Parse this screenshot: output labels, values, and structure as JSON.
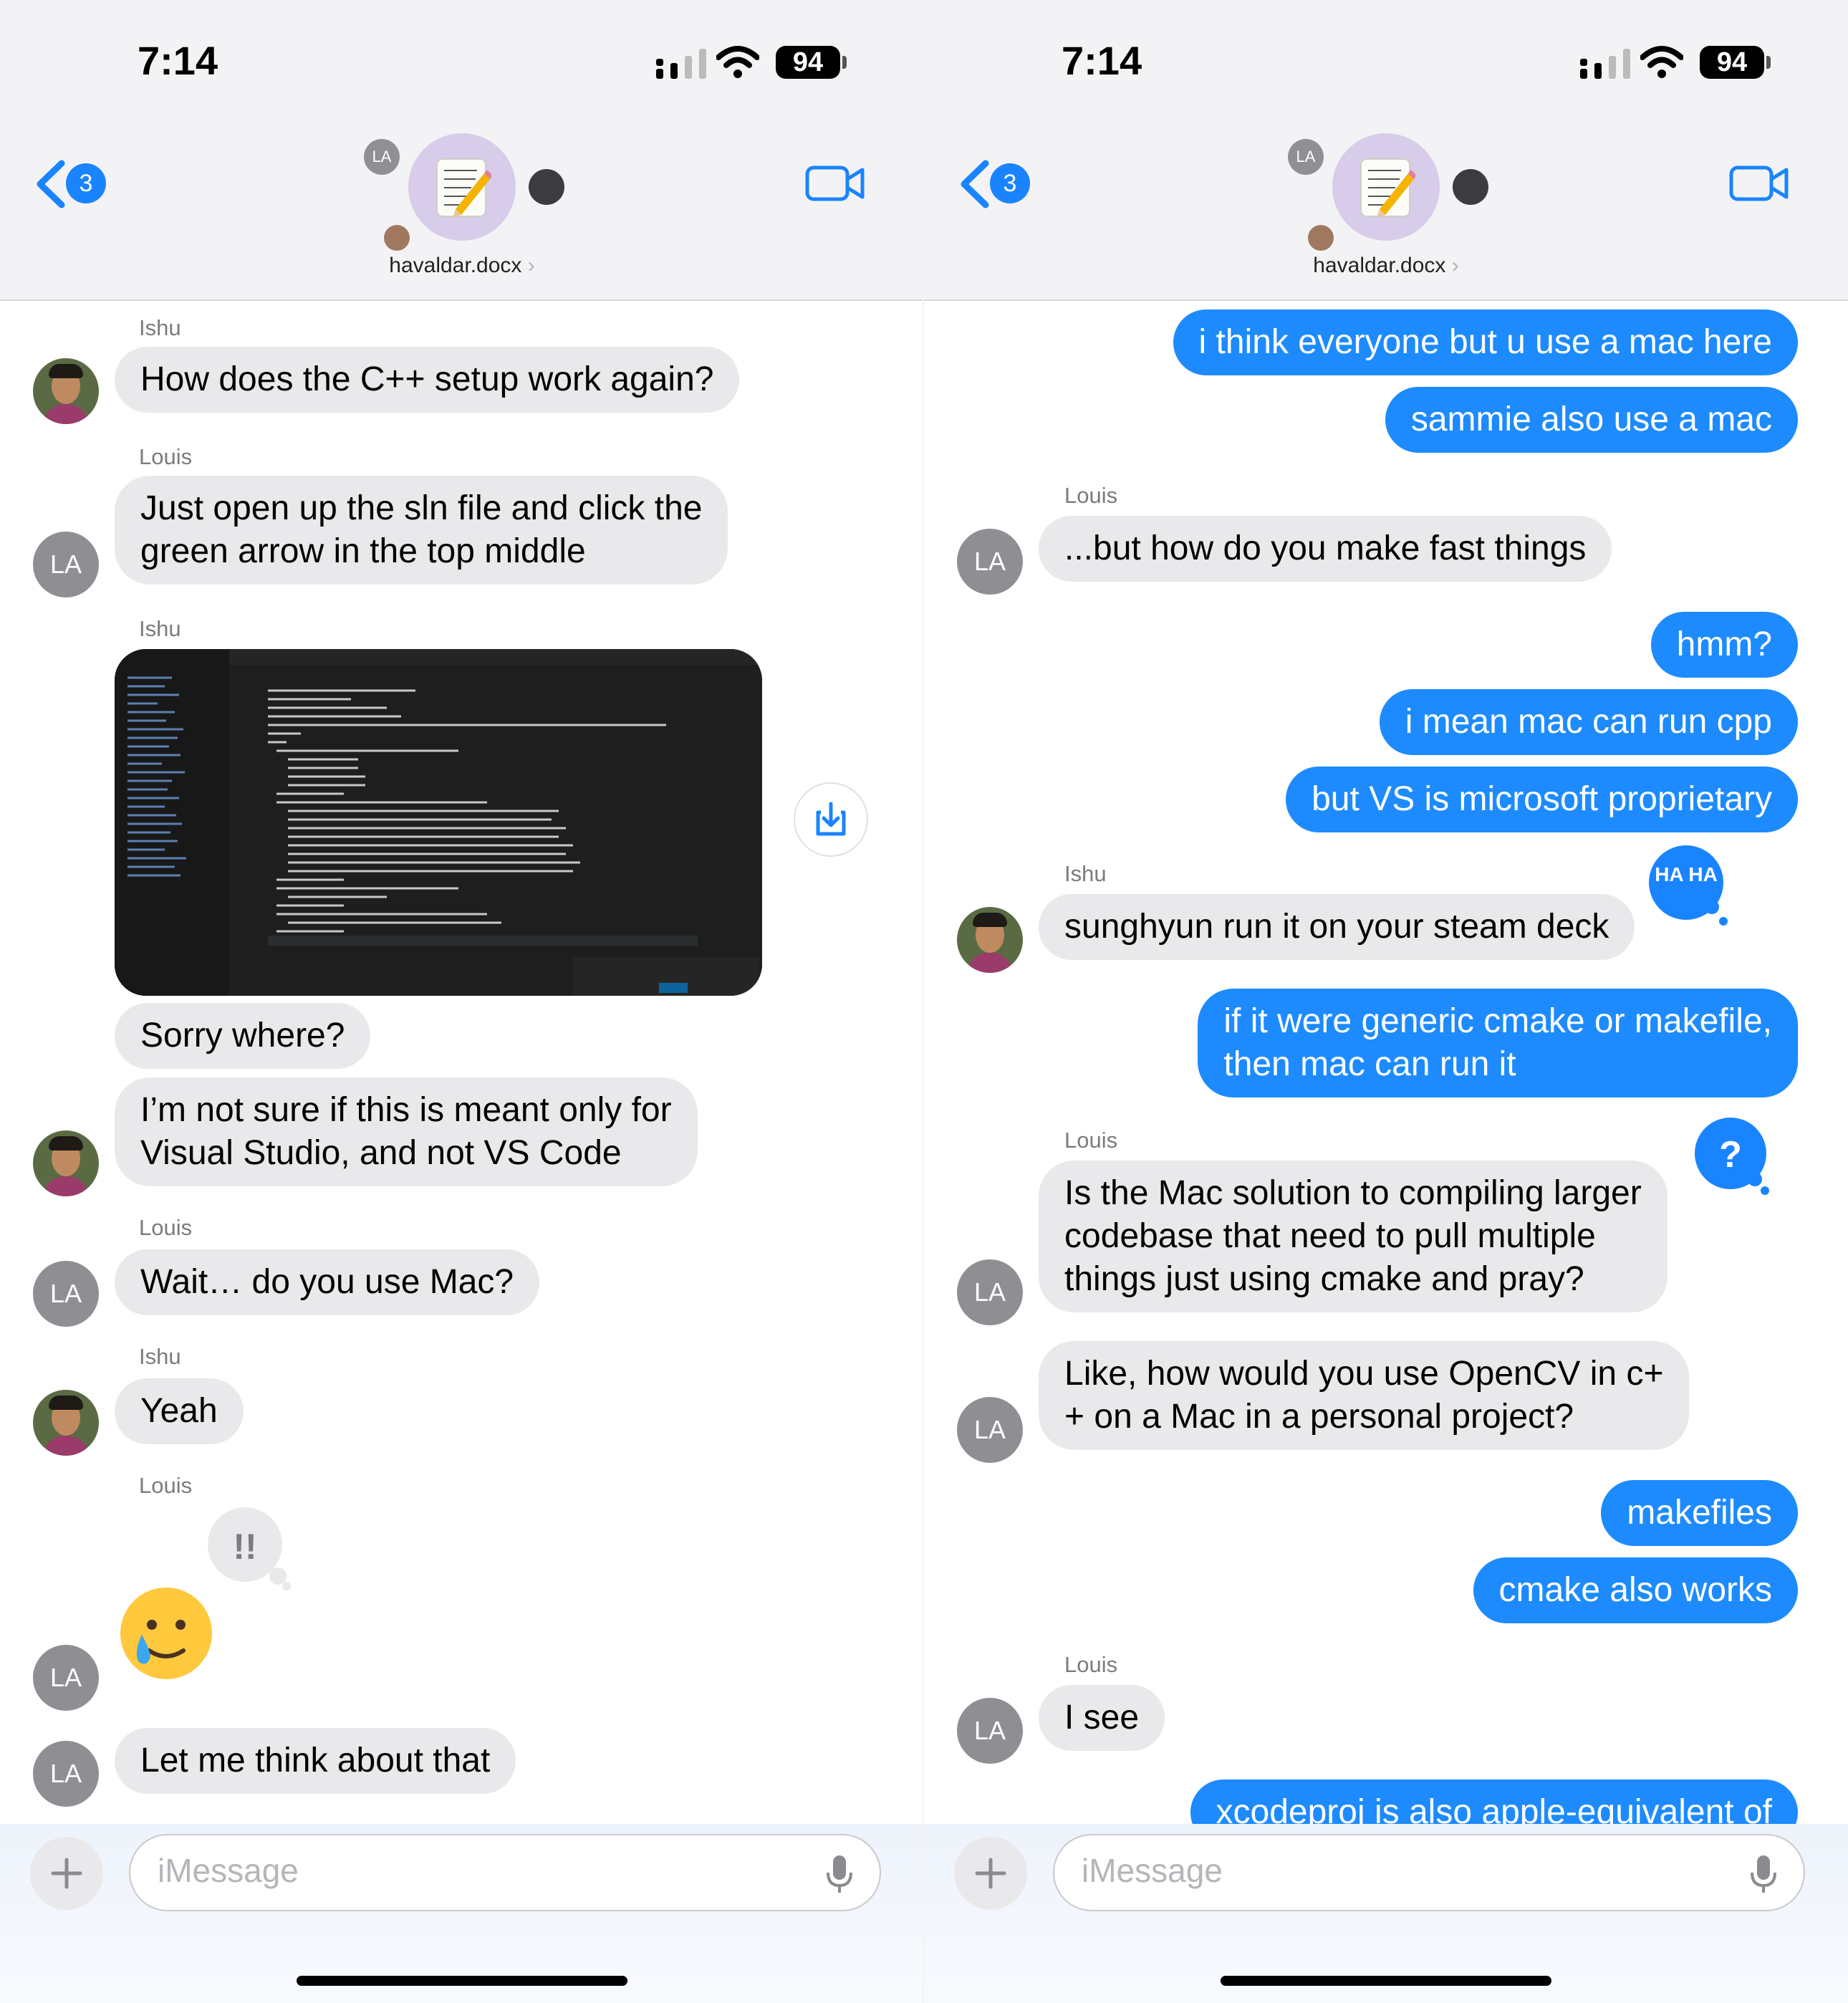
{
  "status_bar": {
    "time": "7:14",
    "battery": "94"
  },
  "header": {
    "back_count": "3",
    "group_name": "havaldar.docx",
    "member_initials": "LA"
  },
  "input": {
    "placeholder": "iMessage"
  },
  "left_screen": {
    "messages": [
      {
        "sender": "Ishu",
        "text": "How does the C++ setup work again?",
        "direction": "incoming"
      },
      {
        "sender": "Louis",
        "lines": [
          "Just open up the sln file and click the",
          "green arrow in the top middle"
        ],
        "direction": "incoming"
      },
      {
        "sender": "Ishu",
        "attachment": "screenshot",
        "direction": "incoming"
      },
      {
        "text": "Sorry where?",
        "direction": "incoming"
      },
      {
        "lines": [
          "I’m not sure if this is meant only for",
          "Visual Studio, and not VS Code"
        ],
        "direction": "incoming"
      },
      {
        "sender": "Louis",
        "text": "Wait… do you use Mac?",
        "direction": "incoming"
      },
      {
        "sender": "Ishu",
        "text": "Yeah",
        "direction": "incoming"
      },
      {
        "sender": "Louis",
        "emoji": "tearful-smile",
        "tapback": "!!",
        "direction": "incoming"
      },
      {
        "text": "Let me think about that",
        "direction": "incoming"
      }
    ]
  },
  "right_screen": {
    "messages": [
      {
        "text": "i think everyone but u use a mac here",
        "direction": "outgoing"
      },
      {
        "text": "sammie also use a mac",
        "direction": "outgoing"
      },
      {
        "sender": "Louis",
        "text": "...but how do you make fast things",
        "direction": "incoming"
      },
      {
        "text": "hmm?",
        "direction": "outgoing"
      },
      {
        "text": "i mean mac can run cpp",
        "direction": "outgoing"
      },
      {
        "text": "but VS is microsoft proprietary",
        "direction": "outgoing"
      },
      {
        "sender": "Ishu",
        "text": "sunghyun run it on your steam deck",
        "tapback": "HA HA",
        "direction": "incoming"
      },
      {
        "lines": [
          "if it were generic cmake or makefile,",
          "then mac can run it"
        ],
        "direction": "outgoing"
      },
      {
        "sender": "Louis",
        "lines": [
          "Is the Mac solution to compiling larger",
          "codebase that need to pull multiple",
          "things just using cmake and pray?"
        ],
        "tapback": "?",
        "direction": "incoming"
      },
      {
        "lines": [
          "Like, how would you use OpenCV in c+",
          "+ on a Mac in a personal project?"
        ],
        "direction": "incoming"
      },
      {
        "text": "makefiles",
        "direction": "outgoing"
      },
      {
        "text": "cmake also works",
        "direction": "outgoing"
      },
      {
        "sender": "Louis",
        "text": "I see",
        "direction": "incoming"
      },
      {
        "text": "xcodeproj is also apple-equivalent of",
        "direction": "outgoing"
      }
    ]
  },
  "colors": {
    "outgoing_bubble": "#1d8bfd",
    "incoming_bubble": "#e9e9eb",
    "accent": "#1a84ff"
  }
}
